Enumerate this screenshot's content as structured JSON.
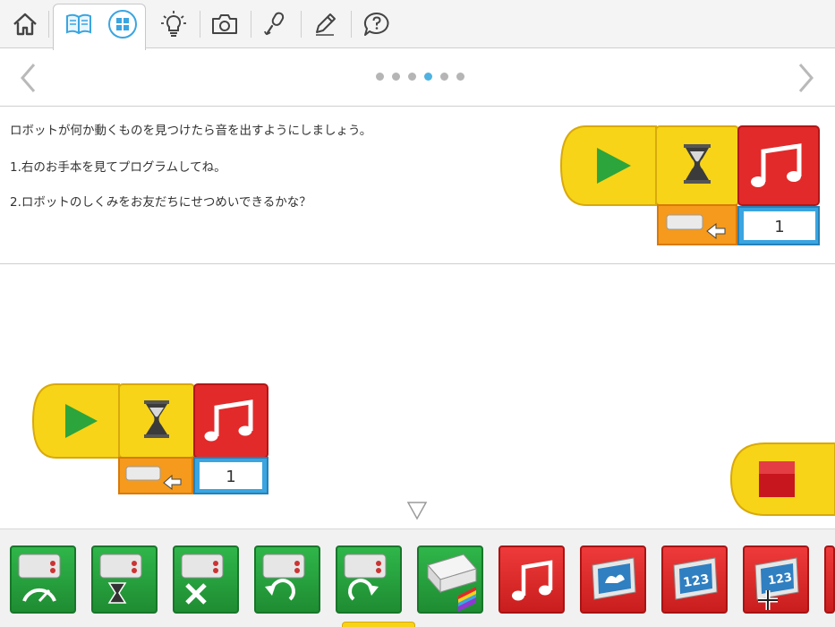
{
  "toolbar": {
    "items": [
      "home",
      "book",
      "grid",
      "lightbulb",
      "camera",
      "microphone",
      "pencil",
      "question"
    ]
  },
  "pager": {
    "page_count": 6,
    "active_page": 4
  },
  "instructions": {
    "line1": "ロボットが何か動くものを見つけたら音を出すようにしましょう。",
    "line2": "1.右のお手本を見てプログラムしてね。",
    "line3": "2.ロボットのしくみをお友だちにせつめいできるかな？"
  },
  "example_program": {
    "blocks": [
      "start",
      "wait",
      "sound"
    ],
    "sensor": "motion-sensor",
    "sound_value": "1"
  },
  "workspace_program": {
    "blocks": [
      "start",
      "wait",
      "sound"
    ],
    "sensor": "motion-sensor",
    "sound_value": "1"
  },
  "palette": {
    "blocks": [
      {
        "name": "motor-power",
        "color": "green"
      },
      {
        "name": "motor-on-for",
        "color": "green"
      },
      {
        "name": "motor-off",
        "color": "green"
      },
      {
        "name": "motor-direction-left",
        "color": "green"
      },
      {
        "name": "motor-direction-right",
        "color": "green"
      },
      {
        "name": "light",
        "color": "green"
      },
      {
        "name": "sound",
        "color": "red"
      },
      {
        "name": "display-background",
        "color": "red"
      },
      {
        "name": "display-number",
        "color": "red"
      },
      {
        "name": "display-add-number",
        "color": "red"
      }
    ]
  },
  "colors": {
    "block_yellow": "#f7d417",
    "block_red": "#e22a2a",
    "block_green": "#27a63d",
    "sensor_orange": "#f59a1c",
    "value_blue": "#3aa5e0",
    "accent_blue": "#4fb2e0"
  }
}
